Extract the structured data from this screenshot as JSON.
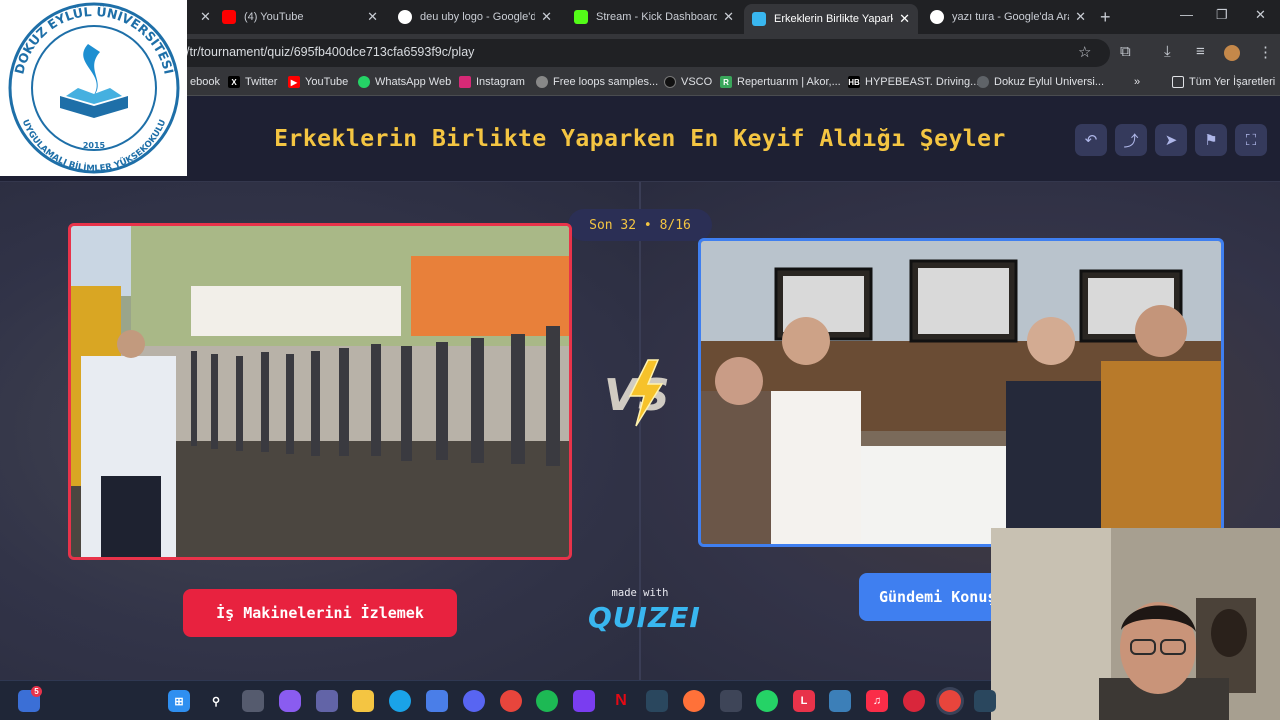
{
  "browser": {
    "tabs": [
      {
        "title": "(4) YouTube",
        "favicon": "youtube-icon",
        "color": "#ff0000"
      },
      {
        "title": "deu uby logo - Google'da Ara",
        "favicon": "google-icon",
        "color": "#4285f4"
      },
      {
        "title": "Stream - Kick Dashboard",
        "favicon": "kick-icon",
        "color": "#53fc18"
      },
      {
        "title": "Erkeklerin Birlikte Yaparken En Keyif Aldığı Şeyler",
        "favicon": "quizei-icon",
        "color": "#39b7f0",
        "active": true
      },
      {
        "title": "yazı tura - Google'da Ara",
        "favicon": "google-icon",
        "color": "#4285f4"
      }
    ],
    "url": "/tr/tournament/quiz/695fb400dce713cfa6593f9c/play",
    "bookmarks": [
      {
        "label": "ebook",
        "icon": "facebook-icon"
      },
      {
        "label": "Twitter",
        "icon": "x-icon"
      },
      {
        "label": "YouTube",
        "icon": "youtube-icon"
      },
      {
        "label": "WhatsApp Web",
        "icon": "whatsapp-icon"
      },
      {
        "label": "Instagram",
        "icon": "instagram-icon"
      },
      {
        "label": "Free loops samples...",
        "icon": "loops-icon"
      },
      {
        "label": "VSCO",
        "icon": "vsco-icon"
      },
      {
        "label": "Repertuarım | Akor,...",
        "icon": "repertuar-icon"
      },
      {
        "label": "HYPEBEAST. Driving...",
        "icon": "hypebeast-icon"
      },
      {
        "label": "Dokuz Eylul Universi...",
        "icon": "globe-icon"
      }
    ],
    "all_bookmarks_label": "Tüm Yer İşaretleri"
  },
  "quiz": {
    "title": "Erkeklerin Birlikte Yaparken En Keyif Aldığı Şeyler",
    "round": "Son 32 • 8/16",
    "vs_label": "VS",
    "left_choice": "İş Makinelerini İzlemek",
    "right_choice": "Gündemi Konuşmak",
    "made_with": "made with",
    "brand": "QUIZEI",
    "accent_left": "#e8223f",
    "accent_right": "#3f7ff0",
    "title_color": "#f4c542"
  },
  "logo": {
    "arc_text": "DOKUZ EYLÜL ÜNİVERSİTESİ",
    "bottom_text": "UYGULAMALI BİLİMLER YÜKSEKOKULU",
    "year": "2015"
  },
  "taskbar": {
    "notification_count": "5",
    "icons": [
      "start-icon",
      "search-icon",
      "task-view-icon",
      "copilot-icon",
      "teams-icon",
      "explorer-icon",
      "edge-icon",
      "store-icon",
      "discord-icon",
      "chrome-icon",
      "spotify-icon",
      "affinity-icon",
      "netflix-icon",
      "steam-icon",
      "firefox-icon",
      "notepad-icon",
      "whatsapp-icon",
      "lasso-icon",
      "monitor-icon",
      "music-icon",
      "app-red-icon",
      "chrome-active-icon",
      "steam2-icon"
    ]
  }
}
